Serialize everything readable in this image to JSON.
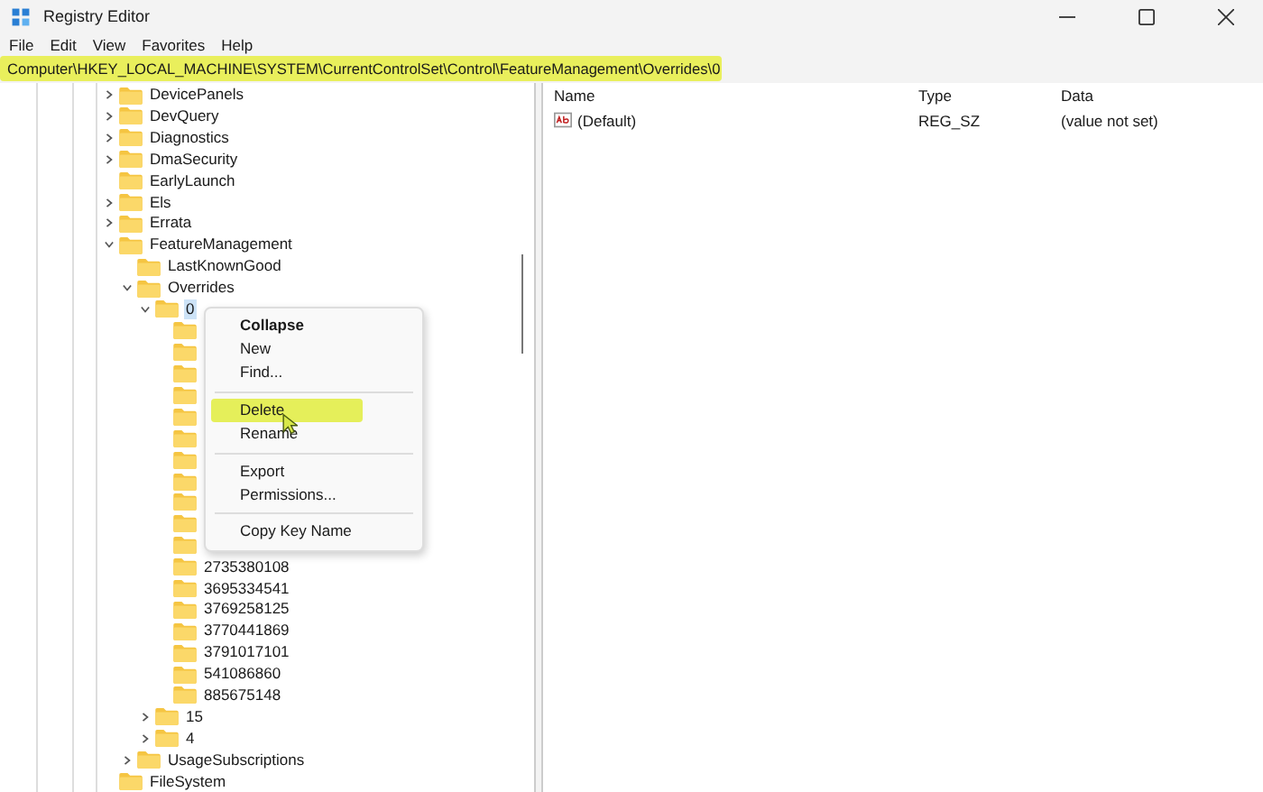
{
  "window": {
    "title": "Registry Editor"
  },
  "menu_bar": [
    "File",
    "Edit",
    "View",
    "Favorites",
    "Help"
  ],
  "address_bar": {
    "value": "Computer\\HKEY_LOCAL_MACHINE\\SYSTEM\\CurrentControlSet\\Control\\FeatureManagement\\Overrides\\0"
  },
  "tree": [
    {
      "label": "DevicePanels",
      "expanded": false
    },
    {
      "label": "DevQuery",
      "expanded": false
    },
    {
      "label": "Diagnostics",
      "expanded": false
    },
    {
      "label": "DmaSecurity",
      "expanded": false
    },
    {
      "label": "EarlyLaunch"
    },
    {
      "label": "Els",
      "expanded": false
    },
    {
      "label": "Errata",
      "expanded": false
    },
    {
      "label": "FeatureManagement",
      "expanded": true,
      "children": [
        {
          "label": "LastKnownGood"
        },
        {
          "label": "Overrides",
          "expanded": true,
          "children": [
            {
              "label": "0",
              "expanded": true,
              "selected": true,
              "children": [
                {
                  "kind": "covered"
                },
                {
                  "kind": "covered"
                },
                {
                  "kind": "covered"
                },
                {
                  "kind": "covered"
                },
                {
                  "kind": "covered"
                },
                {
                  "kind": "covered"
                },
                {
                  "kind": "covered"
                },
                {
                  "kind": "covered"
                },
                {
                  "kind": "covered"
                },
                {
                  "kind": "covered"
                },
                {
                  "kind": "covered"
                },
                {
                  "kind": "key",
                  "label": "2735380108"
                },
                {
                  "kind": "key",
                  "label": "3695334541"
                },
                {
                  "kind": "key",
                  "label": "3769258125"
                },
                {
                  "kind": "key",
                  "label": "3770441869"
                },
                {
                  "kind": "key",
                  "label": "3791017101"
                },
                {
                  "kind": "key",
                  "label": "541086860"
                },
                {
                  "kind": "key",
                  "label": "885675148"
                }
              ]
            },
            {
              "label": "15",
              "expanded": false
            },
            {
              "label": "4",
              "expanded": false
            }
          ]
        },
        {
          "label": "UsageSubscriptions",
          "expanded": false
        }
      ]
    },
    {
      "label": "FileSystem"
    }
  ],
  "context_menu": [
    {
      "kind": "item",
      "label": "Collapse",
      "bold": true,
      "selected": false
    },
    {
      "kind": "item",
      "label": "New",
      "bold": false,
      "selected": false
    },
    {
      "kind": "item",
      "label": "Find...",
      "bold": false,
      "selected": false
    },
    {
      "kind": "separator"
    },
    {
      "kind": "item",
      "label": "Delete",
      "bold": false,
      "selected": true
    },
    {
      "kind": "item",
      "label": "Rename",
      "bold": false,
      "selected": false
    },
    {
      "kind": "separator"
    },
    {
      "kind": "item",
      "label": "Export",
      "bold": false,
      "selected": false
    },
    {
      "kind": "item",
      "label": "Permissions...",
      "bold": false,
      "selected": false
    },
    {
      "kind": "separator"
    },
    {
      "kind": "item",
      "label": "Copy Key Name",
      "bold": false,
      "selected": false
    }
  ],
  "values_table": {
    "columns": [
      "Name",
      "Type",
      "Data"
    ],
    "rows": [
      {
        "name": "(Default)",
        "type": "REG_SZ",
        "data": "(value not set)"
      }
    ]
  }
}
